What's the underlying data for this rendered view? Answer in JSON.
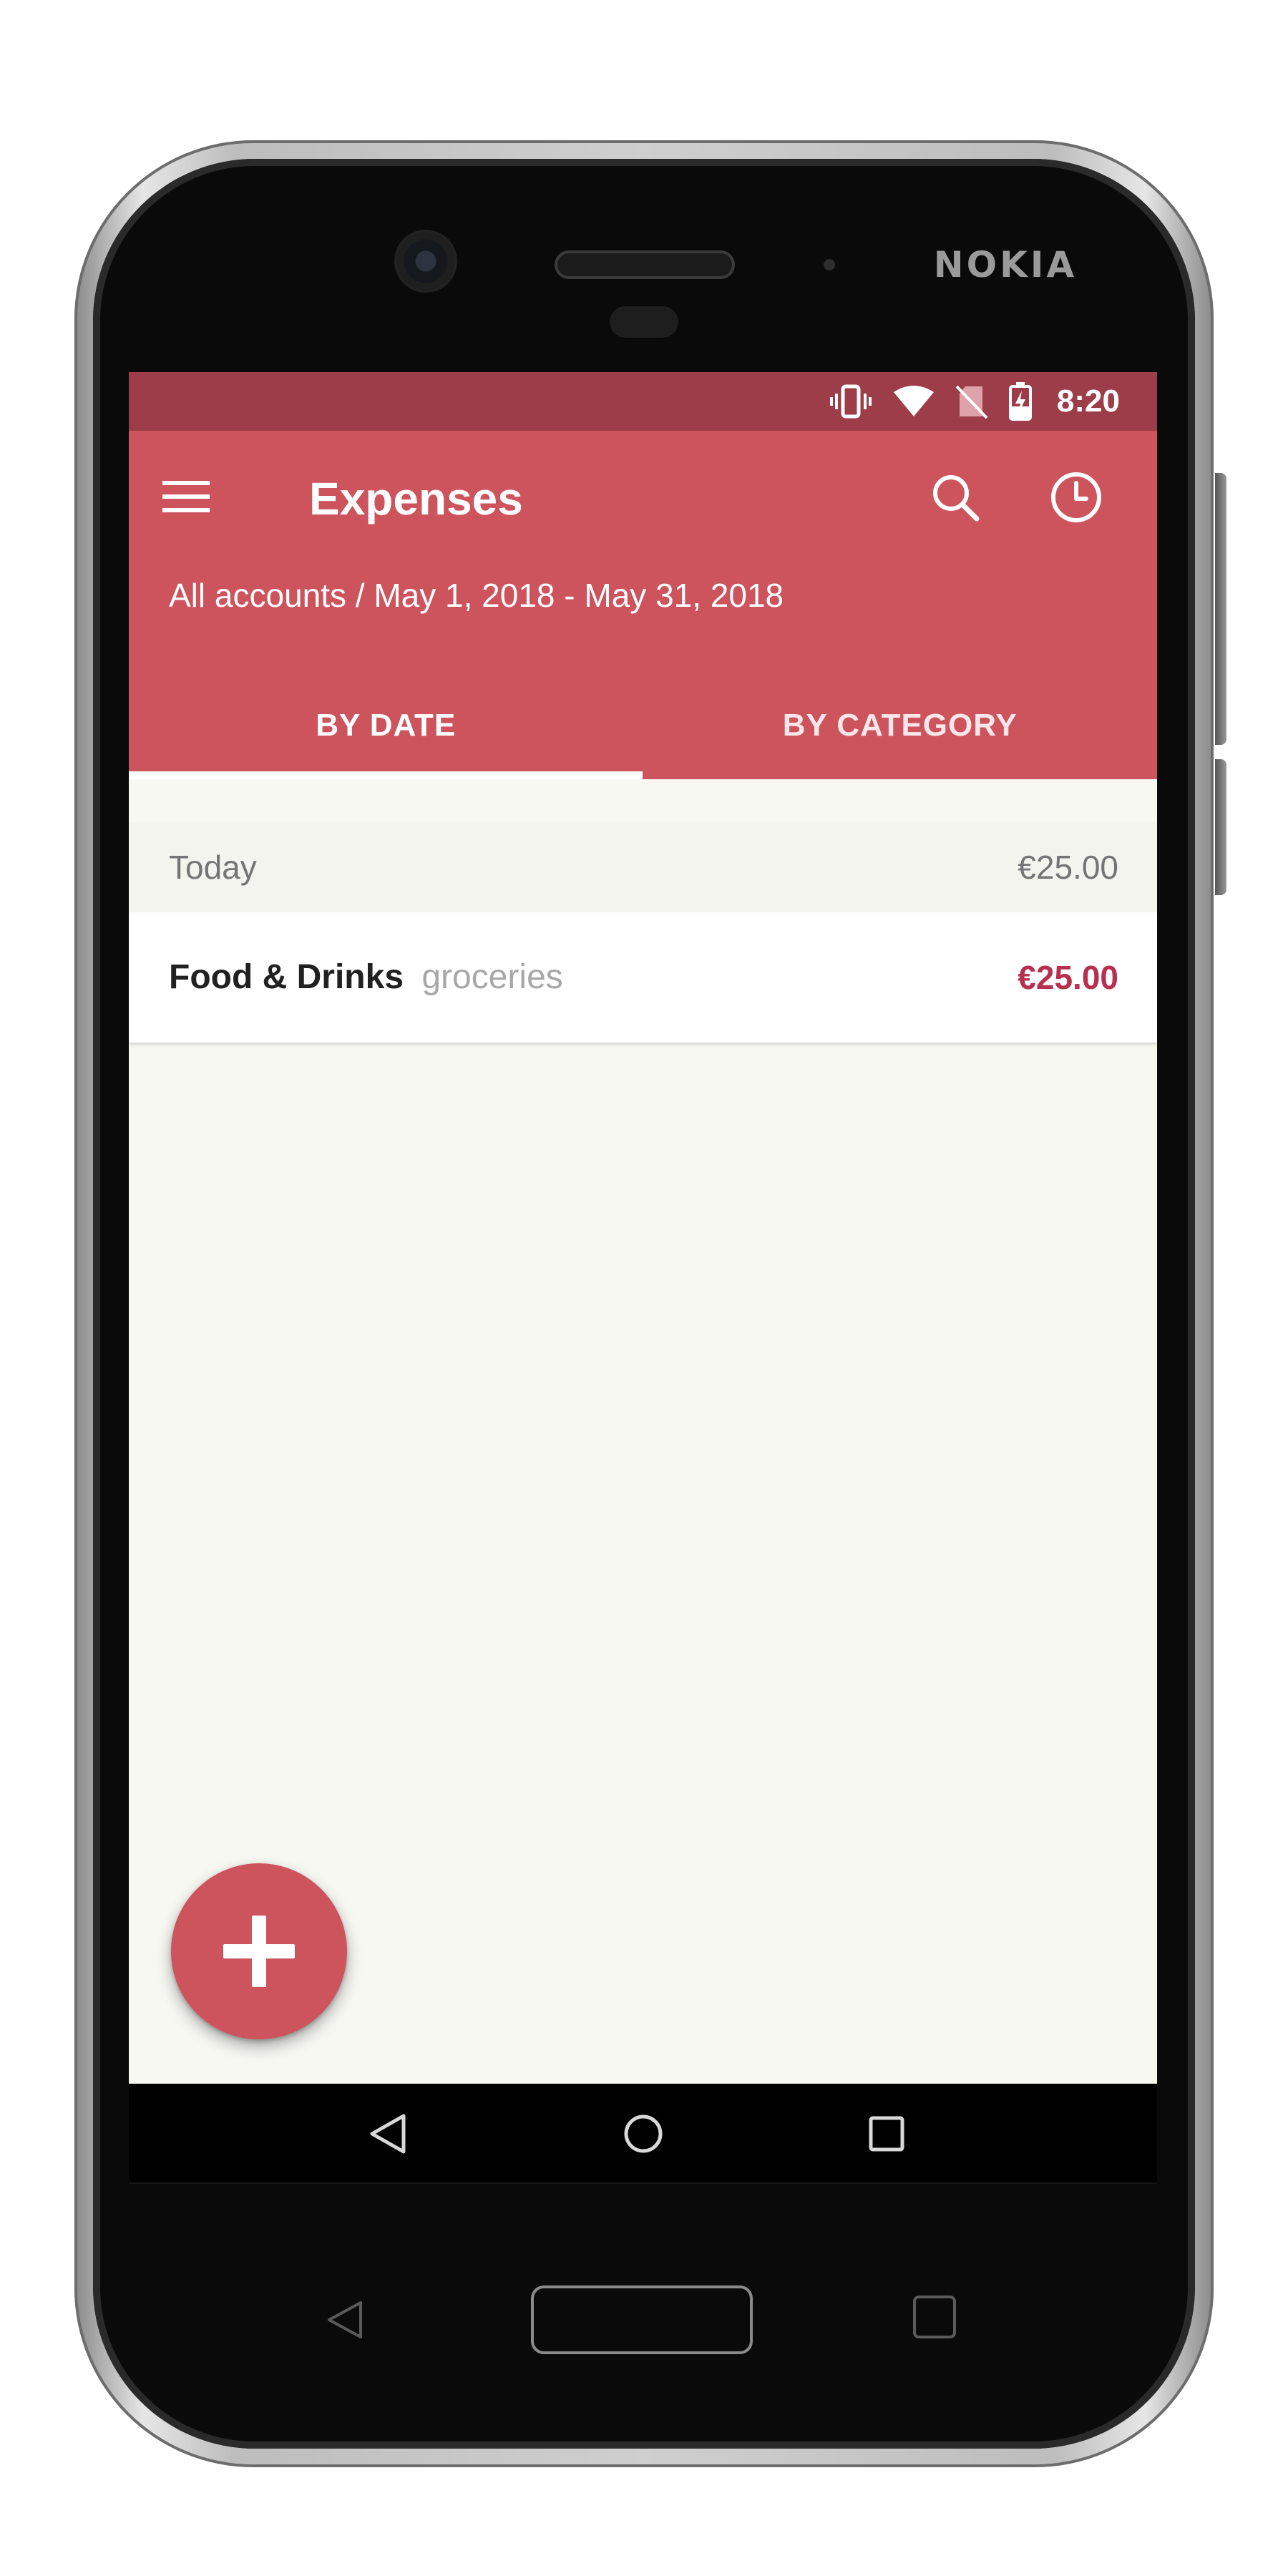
{
  "device": {
    "brand": "NOKIA"
  },
  "status_bar": {
    "time": "8:20",
    "icons": [
      "vibrate-icon",
      "wifi-icon",
      "no-sim-icon",
      "battery-charging-icon"
    ],
    "color": "#9c3d49"
  },
  "app_bar": {
    "title": "Expenses",
    "subtitle": "All accounts / May 1, 2018 - May 31, 2018",
    "color": "#cd535d",
    "actions": [
      "search-icon",
      "history-icon"
    ],
    "menu_icon": "menu-icon"
  },
  "tabs": {
    "items": [
      {
        "label": "BY DATE",
        "selected": true
      },
      {
        "label": "BY CATEGORY",
        "selected": false
      }
    ]
  },
  "expenses": {
    "group": {
      "label": "Today",
      "total": "€25.00"
    },
    "items": [
      {
        "category": "Food & Drinks",
        "note": "groceries",
        "amount": "€25.00"
      }
    ],
    "amount_color": "#b8304f"
  },
  "fab": {
    "icon": "plus-icon",
    "color": "#cd535d"
  },
  "navigation": {
    "icons": [
      "back-icon",
      "home-icon",
      "recents-icon"
    ]
  }
}
